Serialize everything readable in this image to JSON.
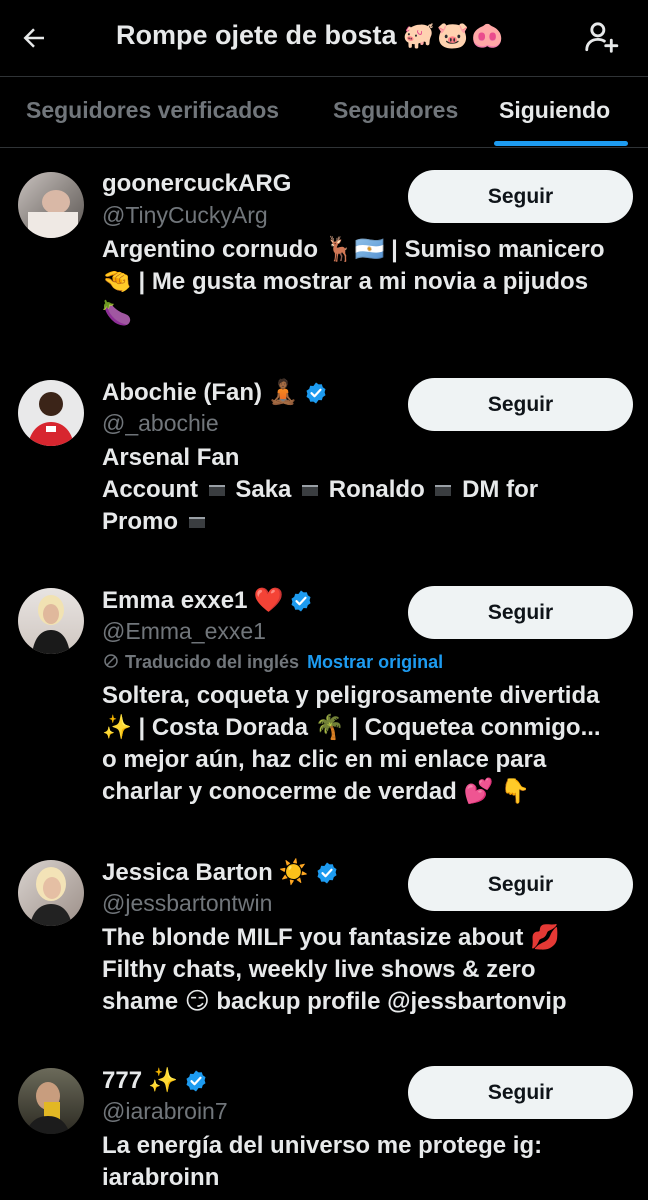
{
  "header": {
    "title": "Rompe ojete de bosta",
    "title_emojis": "🐖🐷🐽",
    "back_icon": "back-arrow-icon",
    "add_icon": "add-person-icon"
  },
  "tabs": [
    {
      "label": "Seguidores verificados",
      "active": false
    },
    {
      "label": "Seguidores",
      "active": false
    },
    {
      "label": "Siguiendo",
      "active": true
    }
  ],
  "accent_color": "#1d9bf0",
  "users": [
    {
      "name": "goonercuckARG",
      "name_emoji": "",
      "verified": false,
      "handle": "@TinyCuckyArg",
      "button": "Seguir",
      "bio_lines": [
        "Argentino cornudo 🦌🇦🇷 | Sumiso manicero",
        "🤏 | Me gusta mostrar a mi novia a pijudos",
        "🍆"
      ]
    },
    {
      "name": "Abochie (Fan)",
      "name_emoji": "🧘🏾",
      "verified": true,
      "handle": "@_abochie",
      "button": "Seguir",
      "bio_lines": [
        "Arsenal Fan",
        "Account",
        "Saka",
        "Ronaldo",
        "DM for",
        "Promo"
      ]
    },
    {
      "name": "Emma exxe1",
      "name_emoji": "❤️",
      "verified": true,
      "handle": "@Emma_exxe1",
      "button": "Seguir",
      "translated_label": "Traducido del inglés",
      "translated_link": "Mostrar original",
      "bio_lines": [
        "Soltera, coqueta y peligrosamente divertida",
        "✨ | Costa Dorada 🌴 | Coquetea conmigo...",
        "o mejor aún, haz clic en mi enlace para",
        "charlar y conocerme de verdad 💕 👇"
      ]
    },
    {
      "name": "Jessica Barton",
      "name_emoji": "☀️",
      "verified": true,
      "handle": "@jessbartontwin",
      "button": "Seguir",
      "bio_lines": [
        "The blonde MILF you fantasize about 💋",
        "Filthy chats, weekly live shows & zero",
        "shame 😏 backup profile @jessbartonvip"
      ]
    },
    {
      "name": "777",
      "name_emoji": "✨",
      "verified": true,
      "handle": "@iarabroin7",
      "button": "Seguir",
      "bio_lines": [
        "La energía del universo me protege ig:",
        "iarabroinn"
      ]
    }
  ]
}
